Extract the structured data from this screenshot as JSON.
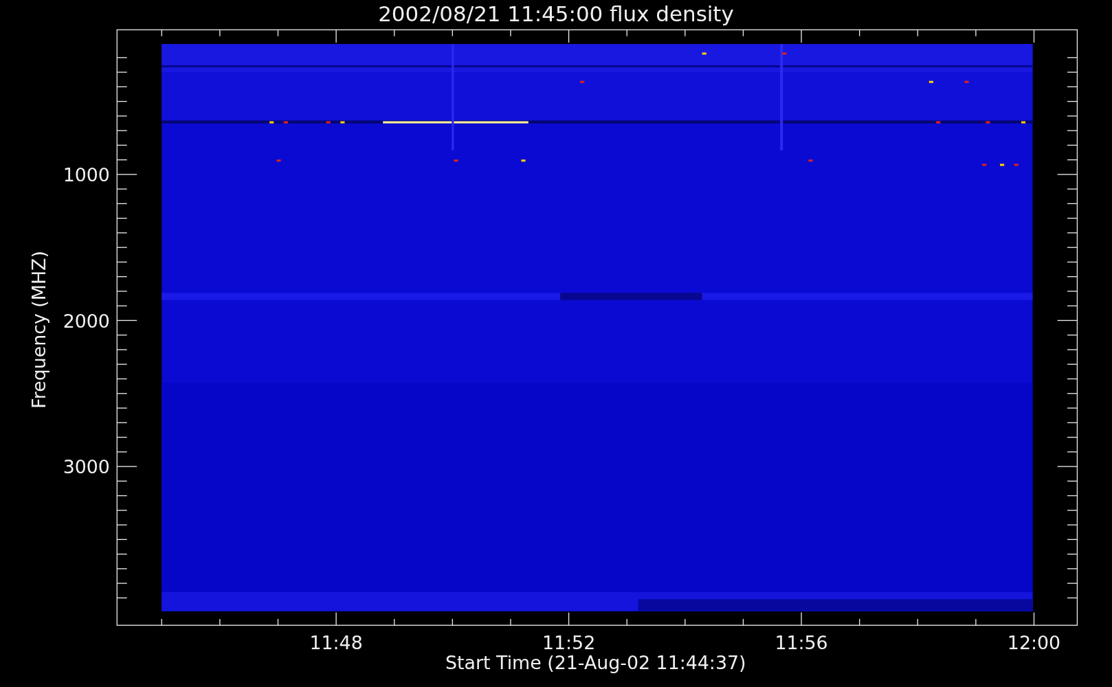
{
  "title": "2002/08/21 11:45:00 flux density",
  "y_axis": {
    "label": "Frequency (MHZ)",
    "tick_labels": [
      "1000",
      "2000",
      "3000"
    ]
  },
  "x_axis": {
    "label": "Start Time (21-Aug-02 11:44:37)",
    "tick_labels": [
      "11:48",
      "11:52",
      "11:56",
      "12:00"
    ]
  }
}
